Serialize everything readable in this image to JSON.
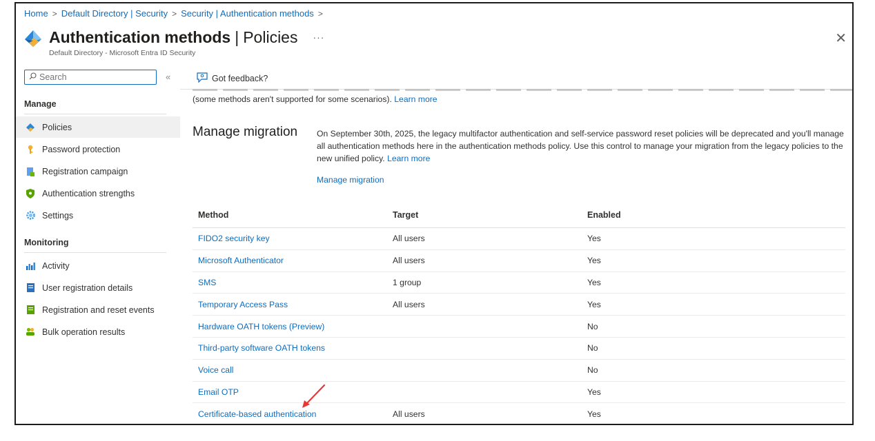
{
  "breadcrumb": [
    "Home",
    "Default Directory | Security",
    "Security | Authentication methods"
  ],
  "header": {
    "title_bold": "Authentication methods",
    "title_rest": "Policies",
    "more": "···",
    "subtitle": "Default Directory - Microsoft Entra ID Security",
    "close": "✕"
  },
  "search": {
    "placeholder": "Search",
    "collapse": "«"
  },
  "sidebar": {
    "manage_label": "Manage",
    "manage_items": [
      {
        "label": "Policies",
        "icon": "diamond-icon",
        "active": true
      },
      {
        "label": "Password protection",
        "icon": "key-icon"
      },
      {
        "label": "Registration campaign",
        "icon": "clipboard-icon"
      },
      {
        "label": "Authentication strengths",
        "icon": "shield-icon"
      },
      {
        "label": "Settings",
        "icon": "gear-icon"
      }
    ],
    "monitoring_label": "Monitoring",
    "monitoring_items": [
      {
        "label": "Activity",
        "icon": "chart-icon"
      },
      {
        "label": "User registration details",
        "icon": "document-icon"
      },
      {
        "label": "Registration and reset events",
        "icon": "log-icon"
      },
      {
        "label": "Bulk operation results",
        "icon": "users-icon"
      }
    ]
  },
  "toolbar": {
    "feedback": "Got feedback?"
  },
  "intro": {
    "text": "(some methods aren't supported for some scenarios).",
    "link": "Learn more"
  },
  "migration": {
    "heading": "Manage migration",
    "description": "On September 30th, 2025, the legacy multifactor authentication and self-service password reset policies will be deprecated and you'll manage all authentication methods here in the authentication methods policy. Use this control to manage your migration from the legacy policies to the new unified policy.",
    "learn_more": "Learn more",
    "link": "Manage migration"
  },
  "table": {
    "headers": [
      "Method",
      "Target",
      "Enabled"
    ],
    "rows": [
      {
        "method": "FIDO2 security key",
        "target": "All users",
        "enabled": "Yes"
      },
      {
        "method": "Microsoft Authenticator",
        "target": "All users",
        "enabled": "Yes"
      },
      {
        "method": "SMS",
        "target": "1 group",
        "enabled": "Yes"
      },
      {
        "method": "Temporary Access Pass",
        "target": "All users",
        "enabled": "Yes"
      },
      {
        "method": "Hardware OATH tokens (Preview)",
        "target": "",
        "enabled": "No"
      },
      {
        "method": "Third-party software OATH tokens",
        "target": "",
        "enabled": "No"
      },
      {
        "method": "Voice call",
        "target": "",
        "enabled": "No"
      },
      {
        "method": "Email OTP",
        "target": "",
        "enabled": "Yes"
      },
      {
        "method": "Certificate-based authentication",
        "target": "All users",
        "enabled": "Yes"
      }
    ]
  },
  "colors": {
    "link": "#0f6cbd",
    "active_bg": "#f0f0f0",
    "annotation_arrow": "#e53935"
  }
}
